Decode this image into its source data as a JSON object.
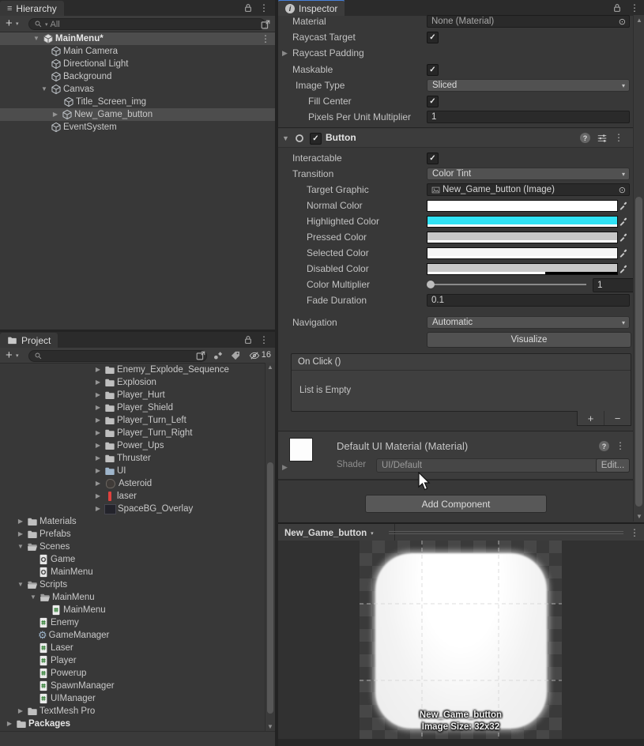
{
  "icons": {
    "kebab": "⋮",
    "plus": "+",
    "dropdown": "▾",
    "open": "▼",
    "closed": "▶",
    "up": "▲",
    "down": "▼",
    "check": "✓",
    "target": "⊙",
    "help": "?",
    "gear": "⚙",
    "info": "i",
    "minus": "−",
    "hierarchy_glyph": "≡"
  },
  "hierarchy": {
    "tab": "Hierarchy",
    "search_placeholder": "All",
    "rows": [
      {
        "label": "MainMenu*",
        "icon": "unity-scene-logo"
      },
      {
        "label": "Main Camera",
        "icon": "cube"
      },
      {
        "label": "Directional Light",
        "icon": "cube"
      },
      {
        "label": "Background",
        "icon": "cube"
      },
      {
        "label": "Canvas",
        "icon": "cube"
      },
      {
        "label": "Title_Screen_img",
        "icon": "cube"
      },
      {
        "label": "New_Game_button",
        "icon": "cube"
      },
      {
        "label": "EventSystem",
        "icon": "cube"
      }
    ]
  },
  "project": {
    "tab": "Project",
    "hidden_count": "16",
    "rows": [
      {
        "label": "Enemy_Explode_Sequence",
        "icon": "folder"
      },
      {
        "label": "Explosion",
        "icon": "folder"
      },
      {
        "label": "Player_Hurt",
        "icon": "folder"
      },
      {
        "label": "Player_Shield",
        "icon": "folder"
      },
      {
        "label": "Player_Turn_Left",
        "icon": "folder"
      },
      {
        "label": "Player_Turn_Right",
        "icon": "folder"
      },
      {
        "label": "Power_Ups",
        "icon": "folder"
      },
      {
        "label": "Thruster",
        "icon": "folder"
      },
      {
        "label": "UI",
        "icon": "folder"
      },
      {
        "label": "Asteroid",
        "icon": "sprite"
      },
      {
        "label": "laser",
        "icon": "laser-sprite"
      },
      {
        "label": "SpaceBG_Overlay",
        "icon": "texture"
      },
      {
        "label": "Materials",
        "icon": "folder"
      },
      {
        "label": "Prefabs",
        "icon": "folder"
      },
      {
        "label": "Scenes",
        "icon": "folder-open"
      },
      {
        "label": "Game",
        "icon": "unity-scene"
      },
      {
        "label": "MainMenu",
        "icon": "unity-scene"
      },
      {
        "label": "Scripts",
        "icon": "folder-open"
      },
      {
        "label": "MainMenu",
        "icon": "folder-open"
      },
      {
        "label": "MainMenu",
        "icon": "csharp-script"
      },
      {
        "label": "Enemy",
        "icon": "csharp-script"
      },
      {
        "label": "GameManager",
        "icon": "gear"
      },
      {
        "label": "Laser",
        "icon": "csharp-script"
      },
      {
        "label": "Player",
        "icon": "csharp-script"
      },
      {
        "label": "Powerup",
        "icon": "csharp-script"
      },
      {
        "label": "SpawnManager",
        "icon": "csharp-script"
      },
      {
        "label": "UIManager",
        "icon": "csharp-script"
      },
      {
        "label": "TextMesh Pro",
        "icon": "folder"
      },
      {
        "label": "Packages",
        "icon": "folder"
      }
    ]
  },
  "inspector": {
    "tab": "Inspector",
    "image_component": {
      "material": {
        "label": "Material",
        "value": "None (Material)"
      },
      "raycast_target": {
        "label": "Raycast Target"
      },
      "raycast_padding": {
        "label": "Raycast Padding"
      },
      "maskable": {
        "label": "Maskable"
      },
      "image_type": {
        "label": "Image Type",
        "value": "Sliced"
      },
      "fill_center": {
        "label": "Fill Center"
      },
      "pixels_per_unit_multiplier": {
        "label": "Pixels Per Unit Multiplier",
        "value": "1"
      }
    },
    "button_component": {
      "title": "Button",
      "interactable": {
        "label": "Interactable"
      },
      "transition": {
        "label": "Transition",
        "value": "Color Tint"
      },
      "target_graphic": {
        "label": "Target Graphic",
        "value": "New_Game_button (Image)"
      },
      "normal_color": {
        "label": "Normal Color",
        "color": "#FFFFFF"
      },
      "highlighted_color": {
        "label": "Highlighted Color",
        "color": "#30E2F5"
      },
      "pressed_color": {
        "label": "Pressed Color",
        "color": "#C8C8C8"
      },
      "selected_color": {
        "label": "Selected Color",
        "color": "#F5F5F5"
      },
      "disabled_color": {
        "label": "Disabled Color",
        "color": "#C8C8C8"
      },
      "color_multiplier": {
        "label": "Color Multiplier",
        "value": "1"
      },
      "fade_duration": {
        "label": "Fade Duration",
        "value": "0.1"
      },
      "navigation": {
        "label": "Navigation",
        "value": "Automatic"
      },
      "visualize_button": "Visualize",
      "on_click": {
        "title": "On Click ()",
        "empty": "List is Empty"
      }
    },
    "material_section": {
      "title": "Default UI Material (Material)",
      "shader": {
        "label": "Shader",
        "value": "UI/Default"
      },
      "edit_button": "Edit..."
    },
    "add_component_button": "Add Component"
  },
  "preview": {
    "target": "New_Game_button",
    "overlay_line1": "New_Game_button",
    "overlay_line2": "Image Size: 32x32"
  }
}
